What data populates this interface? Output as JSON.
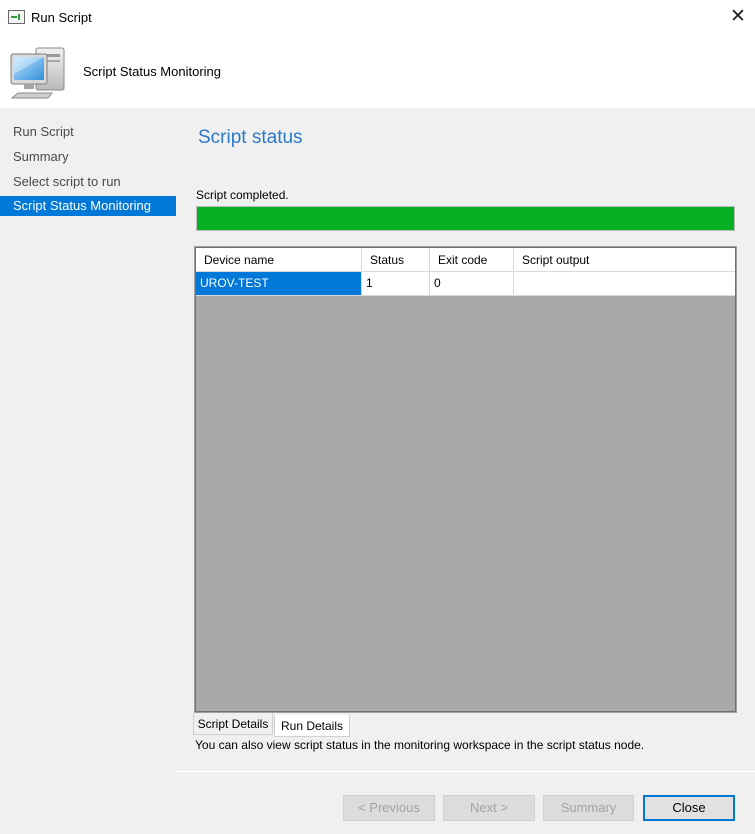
{
  "window": {
    "title": "Run Script",
    "close_glyph": "✕"
  },
  "header": {
    "title": "Script Status Monitoring",
    "icon": "computer-icon"
  },
  "sidebar": {
    "items": [
      {
        "label": "Run Script"
      },
      {
        "label": "Summary"
      },
      {
        "label": "Select script to run"
      },
      {
        "label": "Script Status Monitoring",
        "selected": true
      }
    ]
  },
  "main": {
    "title": "Script status",
    "status_text": "Script completed.",
    "progress_fraction": 1.0,
    "progress_color": "#06b025",
    "grid": {
      "columns": [
        "Device name",
        "Status",
        "Exit code",
        "Script output"
      ],
      "rows": [
        [
          "UROV-TEST",
          "1",
          "0",
          ""
        ]
      ]
    },
    "tabs": [
      {
        "label": "Script Details"
      },
      {
        "label": "Run Details"
      }
    ],
    "footnote": "You can also view script status in the monitoring workspace in the script status node."
  },
  "footer": {
    "previous_label": "< Previous",
    "next_label": "Next >",
    "summary_label": "Summary",
    "close_label": "Close"
  },
  "colors": {
    "accent": "#0078d7",
    "title_blue": "#2b7ac4",
    "grid_bg": "#a9a9a9"
  }
}
